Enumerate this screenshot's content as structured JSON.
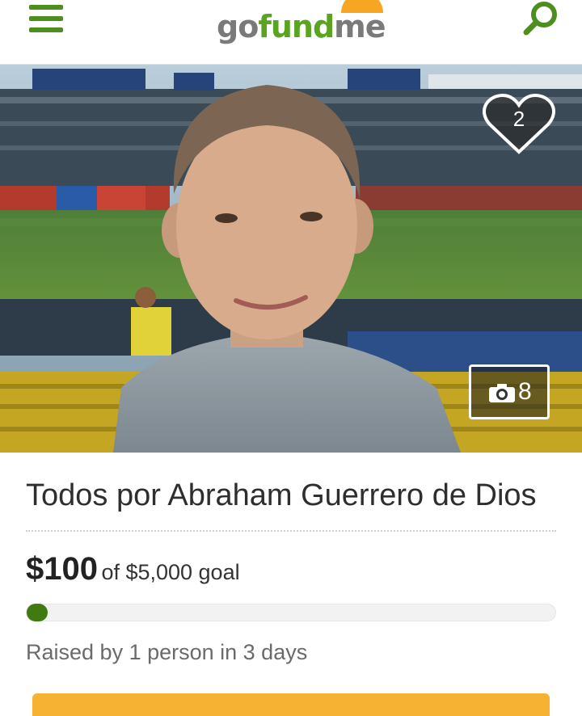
{
  "header": {
    "logo": {
      "part1": "go",
      "part2": "fund",
      "part3": "me"
    },
    "menu_icon": "hamburger-menu-icon",
    "search_icon": "search-icon",
    "brand_color": "#5aa41f"
  },
  "hero": {
    "favorite_count": "2",
    "favorite_icon": "heart-icon",
    "photo_count": "8",
    "photo_icon": "camera-icon"
  },
  "campaign": {
    "title": "Todos por Abraham Guerrero de Dios",
    "raised_amount": "$100",
    "goal_text": "of $5,000 goal",
    "progress_fraction": 0.02,
    "raised_by": "Raised by 1 person in 3 days"
  },
  "donate": {
    "button_color": "#f6b232"
  }
}
